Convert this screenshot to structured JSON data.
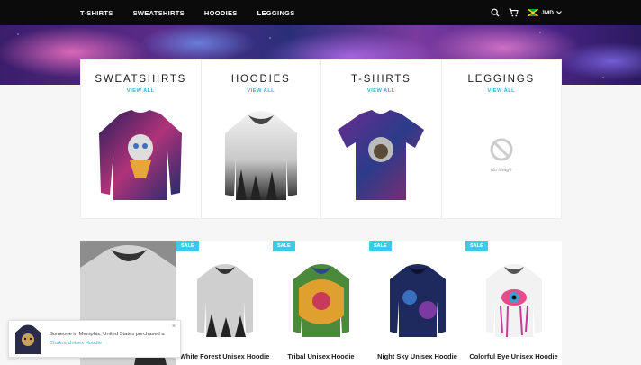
{
  "nav": {
    "items": [
      "T-SHIRTS",
      "SWEATSHIRTS",
      "HOODIES",
      "LEGGINGS"
    ],
    "currency": "JMD",
    "icons": [
      "search-icon",
      "cart-icon",
      "jamaica-flag-icon",
      "chevron-down-icon"
    ]
  },
  "collections": [
    {
      "title": "SWEATSHIRTS",
      "link": "VIEW ALL"
    },
    {
      "title": "HOODIES",
      "link": "VIEW ALL"
    },
    {
      "title": "T-SHIRTS",
      "link": "VIEW ALL"
    },
    {
      "title": "LEGGINGS",
      "link": "VIEW ALL",
      "placeholder": "No image"
    }
  ],
  "products": [
    {
      "badge": "SALE",
      "name": "White Forest Unisex Hoodie"
    },
    {
      "badge": "SALE",
      "name": "Tribal Unisex Hoodie"
    },
    {
      "badge": "SALE",
      "name": "Night Sky Unisex Hoodie"
    },
    {
      "badge": "SALE",
      "name": "Colorful Eye Unisex Hoodie"
    }
  ],
  "popup": {
    "text": "Someone in Memphis, United States purchased a",
    "link": "Chakra Unisex Hoodie",
    "close": "×"
  },
  "colors": {
    "accent": "#36b3d6",
    "badge": "#3fc9e6",
    "nav_bg": "#0b0b0b"
  }
}
